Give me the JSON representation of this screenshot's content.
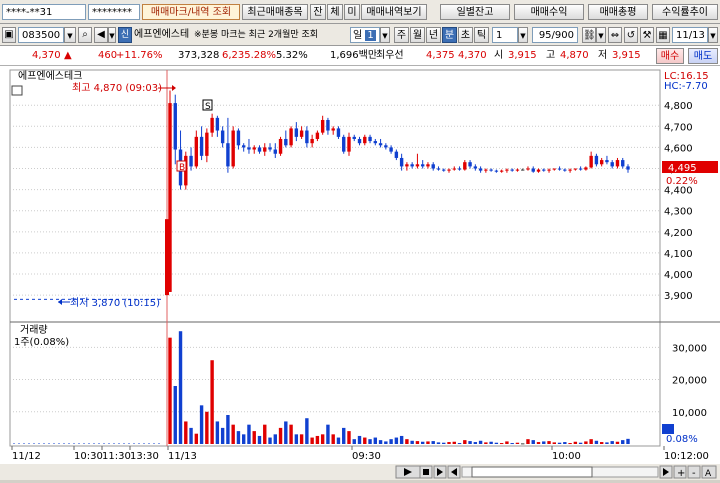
{
  "toolbar1": {
    "account_field": "****-**31",
    "password_field": "********",
    "buttons": [
      "매매마크/내역 조회",
      "최근매매종목",
      "잔",
      "체",
      "미",
      "매매내역보기"
    ],
    "right_buttons": [
      "일별잔고",
      "매매수익",
      "매매총평",
      "수익률추이"
    ]
  },
  "toolbar2": {
    "stock_code": "083500",
    "stock_name": "에프엔에스테",
    "notice": "※분봉 마크는 최근 2개월만 조회",
    "period_selected": "일",
    "period_num": "1",
    "periods": [
      "주",
      "월",
      "년",
      "분",
      "초",
      "틱"
    ],
    "interval": "1",
    "count": "95/900",
    "date": "11/13"
  },
  "quote": {
    "price": "4,370",
    "arrow": "▲",
    "change": "460",
    "change_pct": "+11.76%",
    "volume": "373,328",
    "volume_pct": "6,235.28%",
    "turnover": "5.32%",
    "amount": "1,696백만",
    "best_ask_label": "최우선",
    "best_ask": "4,375",
    "best_bid": "4,370",
    "open_label": "시",
    "open": "3,915",
    "high_label": "고",
    "high": "4,870",
    "low_label": "저",
    "low": "3,915",
    "buy_button": "매수",
    "sell_button": "매도"
  },
  "chart": {
    "title": "에프엔에스테크",
    "lc_label": "LC:16.15",
    "hc_label": "HC:-7.70",
    "high_annotation": "최고 4,870 (09:03)",
    "low_annotation": "최저 3,870 (10:15)",
    "current_price_tag": "4,495",
    "current_pct_tag": "0.22%",
    "volume_title": "거래량",
    "volume_sub": "1주(0.08%)",
    "volume_pct_tag": "0.08%",
    "sell_marker": "S",
    "buy_marker": "B",
    "colors": {
      "up": "#e00000",
      "down": "#1040d0",
      "flat": "#404040"
    }
  },
  "chart_data": {
    "type": "candlestick",
    "price_axis": {
      "ticks": [
        3900,
        4000,
        4100,
        4200,
        4300,
        4400,
        4500,
        4600,
        4700,
        4800
      ],
      "labels": [
        "3,900",
        "4,000",
        "4,100",
        "4,200",
        "4,300",
        "4,400",
        "4,500",
        "4,600",
        "4,700",
        "4,800"
      ],
      "range": [
        3820,
        4910
      ]
    },
    "volume_axis": {
      "ticks": [
        10000,
        20000,
        30000
      ],
      "labels": [
        "10,000",
        "20,000",
        "30,000"
      ],
      "range": [
        0,
        36000
      ]
    },
    "x_labels": [
      "11/12",
      "10:30",
      "11:30",
      "13:30",
      "11/13",
      "09:30",
      "10:00",
      "10:12:00"
    ],
    "prev_day_flat_price": 3880,
    "candles": [
      [
        3915,
        4870,
        3915,
        4810,
        33000
      ],
      [
        4810,
        4850,
        4520,
        4590,
        18000
      ],
      [
        4590,
        4680,
        4400,
        4420,
        35000
      ],
      [
        4420,
        4580,
        4400,
        4560,
        7000
      ],
      [
        4560,
        4600,
        4490,
        4510,
        5000
      ],
      [
        4510,
        4680,
        4500,
        4650,
        3200
      ],
      [
        4650,
        4700,
        4540,
        4560,
        12000
      ],
      [
        4560,
        4690,
        4530,
        4670,
        10000
      ],
      [
        4670,
        4760,
        4650,
        4740,
        26000
      ],
      [
        4740,
        4750,
        4650,
        4680,
        7000
      ],
      [
        4680,
        4700,
        4600,
        4620,
        5000
      ],
      [
        4620,
        4740,
        4480,
        4510,
        9000
      ],
      [
        4510,
        4700,
        4500,
        4680,
        6000
      ],
      [
        4680,
        4690,
        4590,
        4610,
        4000
      ],
      [
        4610,
        4620,
        4580,
        4600,
        3000
      ],
      [
        4600,
        4640,
        4570,
        4590,
        6000
      ],
      [
        4590,
        4610,
        4570,
        4600,
        4000
      ],
      [
        4600,
        4610,
        4570,
        4580,
        2500
      ],
      [
        4580,
        4620,
        4560,
        4600,
        6000
      ],
      [
        4600,
        4620,
        4580,
        4590,
        2000
      ],
      [
        4590,
        4620,
        4550,
        4570,
        3000
      ],
      [
        4570,
        4650,
        4560,
        4640,
        5000
      ],
      [
        4640,
        4680,
        4600,
        4610,
        7000
      ],
      [
        4610,
        4700,
        4600,
        4690,
        6000
      ],
      [
        4690,
        4720,
        4630,
        4650,
        3000
      ],
      [
        4650,
        4700,
        4640,
        4680,
        3000
      ],
      [
        4680,
        4700,
        4600,
        4620,
        8000
      ],
      [
        4620,
        4660,
        4600,
        4640,
        2000
      ],
      [
        4640,
        4680,
        4630,
        4670,
        2500
      ],
      [
        4670,
        4750,
        4660,
        4730,
        3000
      ],
      [
        4730,
        4740,
        4660,
        4680,
        6000
      ],
      [
        4680,
        4700,
        4660,
        4690,
        3000
      ],
      [
        4690,
        4700,
        4640,
        4650,
        2000
      ],
      [
        4650,
        4660,
        4570,
        4580,
        5000
      ],
      [
        4580,
        4670,
        4560,
        4650,
        4000
      ],
      [
        4650,
        4660,
        4630,
        4640,
        1500
      ],
      [
        4640,
        4650,
        4610,
        4620,
        2500
      ],
      [
        4620,
        4660,
        4610,
        4650,
        2000
      ],
      [
        4650,
        4660,
        4620,
        4630,
        1500
      ],
      [
        4630,
        4640,
        4610,
        4620,
        2000
      ],
      [
        4620,
        4640,
        4600,
        4610,
        1200
      ],
      [
        4610,
        4620,
        4590,
        4600,
        800
      ],
      [
        4600,
        4610,
        4570,
        4580,
        1500
      ],
      [
        4580,
        4590,
        4540,
        4550,
        2000
      ],
      [
        4550,
        4570,
        4490,
        4510,
        2500
      ],
      [
        4510,
        4530,
        4490,
        4520,
        1500
      ],
      [
        4520,
        4530,
        4500,
        4510,
        1000
      ],
      [
        4510,
        4570,
        4500,
        4520,
        900
      ],
      [
        4520,
        4540,
        4500,
        4510,
        700
      ],
      [
        4510,
        4530,
        4500,
        4520,
        800
      ],
      [
        4520,
        4530,
        4490,
        4500,
        900
      ],
      [
        4500,
        4510,
        4490,
        4495,
        500
      ],
      [
        4495,
        4500,
        4485,
        4490,
        400
      ],
      [
        4490,
        4500,
        4480,
        4495,
        600
      ],
      [
        4495,
        4510,
        4490,
        4500,
        700
      ],
      [
        4500,
        4510,
        4490,
        4495,
        300
      ],
      [
        4495,
        4540,
        4490,
        4530,
        1200
      ],
      [
        4530,
        4540,
        4500,
        4510,
        900
      ],
      [
        4510,
        4520,
        4490,
        4500,
        600
      ],
      [
        4500,
        4510,
        4480,
        4490,
        1000
      ],
      [
        4490,
        4500,
        4480,
        4495,
        500
      ],
      [
        4495,
        4500,
        4485,
        4490,
        700
      ],
      [
        4490,
        4495,
        4480,
        4485,
        400
      ],
      [
        4485,
        4495,
        4480,
        4490,
        300
      ],
      [
        4490,
        4500,
        4480,
        4495,
        800
      ],
      [
        4495,
        4500,
        4485,
        4490,
        300
      ],
      [
        4490,
        4500,
        4485,
        4495,
        400
      ],
      [
        4495,
        4500,
        4490,
        4495,
        200
      ],
      [
        4495,
        4510,
        4490,
        4500,
        1500
      ],
      [
        4500,
        4510,
        4480,
        4485,
        1200
      ],
      [
        4485,
        4500,
        4480,
        4495,
        600
      ],
      [
        4495,
        4500,
        4485,
        4490,
        800
      ],
      [
        4490,
        4500,
        4480,
        4495,
        900
      ],
      [
        4495,
        4500,
        4490,
        4500,
        500
      ],
      [
        4500,
        4510,
        4490,
        4495,
        400
      ],
      [
        4495,
        4500,
        4485,
        4490,
        600
      ],
      [
        4490,
        4500,
        4480,
        4495,
        300
      ],
      [
        4495,
        4500,
        4490,
        4500,
        700
      ],
      [
        4500,
        4510,
        4490,
        4495,
        400
      ],
      [
        4495,
        4510,
        4490,
        4505,
        800
      ],
      [
        4505,
        4580,
        4500,
        4560,
        1500
      ],
      [
        4560,
        4570,
        4510,
        4520,
        1000
      ],
      [
        4520,
        4550,
        4510,
        4540,
        600
      ],
      [
        4540,
        4560,
        4520,
        4530,
        500
      ],
      [
        4530,
        4540,
        4500,
        4510,
        900
      ],
      [
        4510,
        4550,
        4500,
        4540,
        700
      ],
      [
        4540,
        4550,
        4500,
        4510,
        1200
      ],
      [
        4510,
        4520,
        4480,
        4495,
        1600
      ]
    ]
  }
}
